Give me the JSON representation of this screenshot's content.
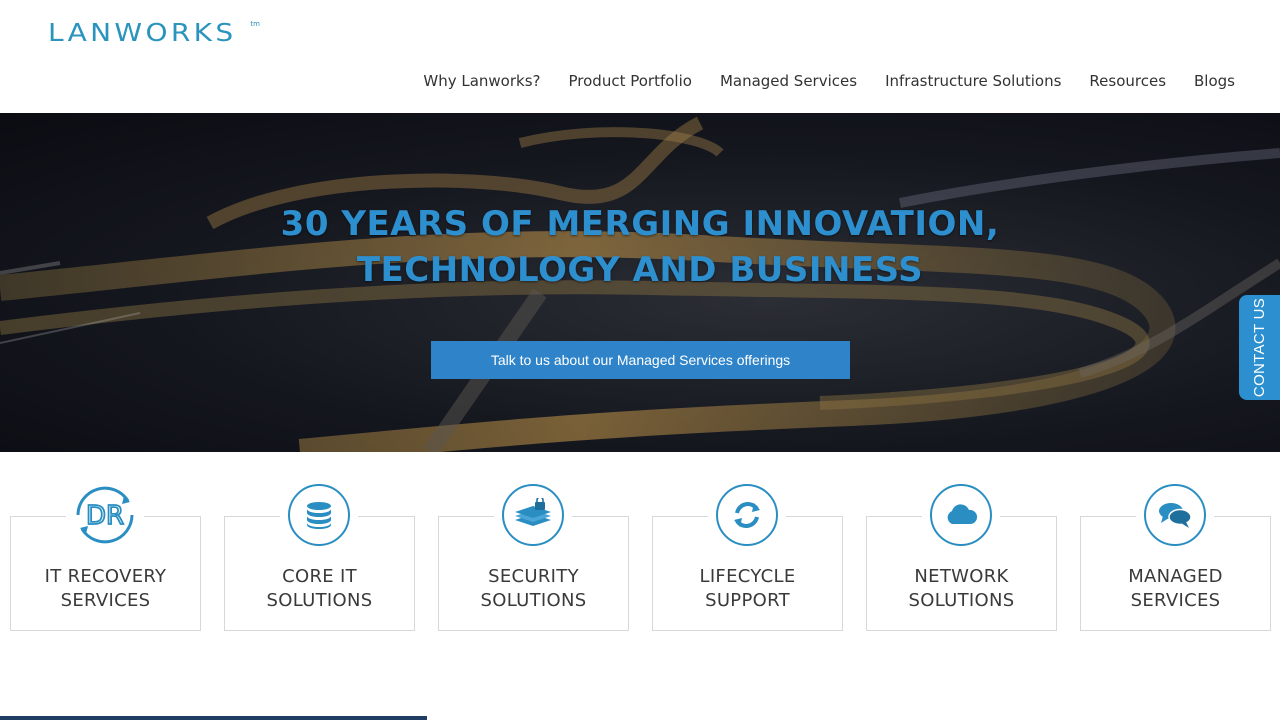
{
  "brand": {
    "name": "LANWORKS",
    "tm": "tm"
  },
  "nav": {
    "items": [
      {
        "label": "Why Lanworks?"
      },
      {
        "label": "Product Portfolio"
      },
      {
        "label": "Managed Services"
      },
      {
        "label": "Infrastructure Solutions"
      },
      {
        "label": "Resources"
      },
      {
        "label": "Blogs"
      }
    ]
  },
  "hero": {
    "title_line1": "30 YEARS OF MERGING INNOVATION,",
    "title_line2": "TECHNOLOGY AND BUSINESS",
    "cta_label": "Talk to us about our Managed Services offerings"
  },
  "contact_tab": {
    "label": "CONTACT US"
  },
  "services": [
    {
      "line1": "IT RECOVERY",
      "line2": "SERVICES",
      "icon": "dr-recovery-icon"
    },
    {
      "line1": "CORE IT",
      "line2": "SOLUTIONS",
      "icon": "database-icon"
    },
    {
      "line1": "SECURITY",
      "line2": "SOLUTIONS",
      "icon": "security-stack-icon"
    },
    {
      "line1": "LIFECYCLE",
      "line2": "SUPPORT",
      "icon": "refresh-icon"
    },
    {
      "line1": "NETWORK",
      "line2": "SOLUTIONS",
      "icon": "cloud-icon"
    },
    {
      "line1": "MANAGED",
      "line2": "SERVICES",
      "icon": "chat-icon"
    }
  ],
  "colors": {
    "accent": "#2a8ec2",
    "cta": "#2f83c9",
    "title": "#2e8fcf",
    "contact_tab": "#2b8fd0"
  }
}
